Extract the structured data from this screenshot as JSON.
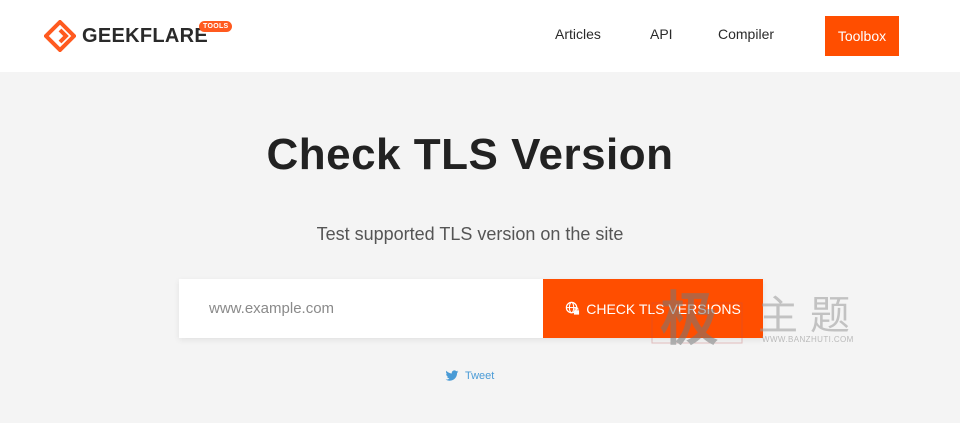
{
  "header": {
    "logo_text": "GEEKFLARE",
    "logo_badge": "TOOLS",
    "nav": {
      "articles": "Articles",
      "api": "API",
      "compiler": "Compiler",
      "toolbox": "Toolbox"
    }
  },
  "main": {
    "title": "Check TLS Version",
    "subtitle": "Test supported TLS version on the site",
    "url_input": {
      "placeholder": "www.example.com",
      "value": ""
    },
    "check_button_label": "CHECK TLS VERSIONS",
    "tweet_label": "Tweet"
  },
  "watermark": {
    "chars": "主题",
    "url": "WWW.BANZHUTI.COM"
  },
  "colors": {
    "accent": "#ff4e00",
    "background": "#f4f4f4",
    "tweet": "#4a9bd6"
  },
  "icons": {
    "logo": "geekflare-logo-icon",
    "check_button": "globe-lock-icon",
    "tweet": "twitter-bird-icon"
  }
}
